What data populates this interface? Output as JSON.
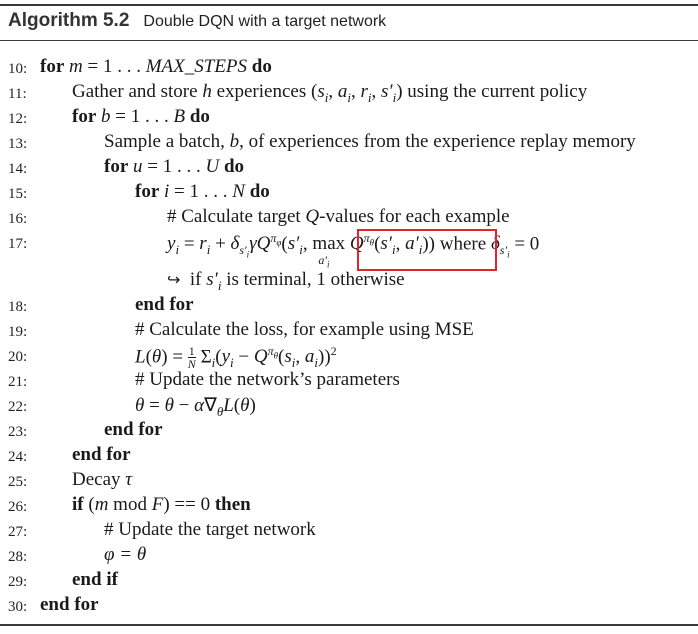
{
  "header": {
    "title": "Algorithm 5.2",
    "caption": "Double DQN with a target network"
  },
  "lines": [
    {
      "n": "10:",
      "text": "for m = 1 . . . MAX_STEPS do"
    },
    {
      "n": "11:",
      "text": "Gather and store h experiences (sᵢ, aᵢ, rᵢ, s′ᵢ) using the current policy"
    },
    {
      "n": "12:",
      "text": "for b = 1 . . . B do"
    },
    {
      "n": "13:",
      "text": "Sample a batch, b, of experiences from the experience replay memory"
    },
    {
      "n": "14:",
      "text": "for u = 1 . . . U do"
    },
    {
      "n": "15:",
      "text": "for i = 1 . . . N do"
    },
    {
      "n": "16:",
      "text": "# Calculate target Q-values for each example"
    },
    {
      "n": "17:",
      "text": "yᵢ = rᵢ + δ_{s′ᵢ} γ Q^{πφ}(s′ᵢ, max_{a′ᵢ} Q^{πθ}(s′ᵢ, a′ᵢ)) where δ_{s′ᵢ} = 0"
    },
    {
      "n": "",
      "text": "↪ if s′ᵢ is terminal, 1 otherwise"
    },
    {
      "n": "18:",
      "text": "end for"
    },
    {
      "n": "19:",
      "text": "# Calculate the loss, for example using MSE"
    },
    {
      "n": "20:",
      "text": "L(θ) = 1/N Σᵢ (yᵢ − Q^{πθ}(sᵢ, aᵢ))²"
    },
    {
      "n": "21:",
      "text": "# Update the network's parameters"
    },
    {
      "n": "22:",
      "text": "θ = θ − α∇θ L(θ)"
    },
    {
      "n": "23:",
      "text": "end for"
    },
    {
      "n": "24:",
      "text": "end for"
    },
    {
      "n": "25:",
      "text": "Decay τ"
    },
    {
      "n": "26:",
      "text": "if (m mod F) == 0 then"
    },
    {
      "n": "27:",
      "text": "# Update the target network"
    },
    {
      "n": "28:",
      "text": "φ = θ"
    },
    {
      "n": "29:",
      "text": "end if"
    },
    {
      "n": "30:",
      "text": "end for"
    }
  ],
  "tokens": {
    "for": "for",
    "do": "do",
    "end_for": "end for",
    "end_if": "end if",
    "if": "if",
    "then": "then",
    "l10_var": "m",
    "l10_eq": " = 1 . . . ",
    "l10_max": "MAX_STEPS",
    "l11_a": "Gather and store ",
    "l11_h": "h",
    "l11_b": " experiences (",
    "l11_s": "s",
    "l11_c": ", ",
    "l11_a2": "a",
    "l11_r": "r",
    "l11_d": ") using the current policy",
    "l12_var": "b",
    "l12_eq": " = 1 . . . ",
    "l12_B": "B",
    "l13": "Sample a batch, ",
    "l13_b": "b",
    "l13_rest": ", of experiences from the experience replay memory",
    "l14_var": "u",
    "l14_eq": " = 1 . . . ",
    "l14_U": "U",
    "l15_var": "i",
    "l15_eq": " = 1 . . . ",
    "l15_N": "N",
    "l16": "# Calculate target ",
    "l16_Q": "Q",
    "l16_rest": "-values for each example",
    "l17_where": " where ",
    "l17b_arrow": "↪",
    "l17b_text1": "if ",
    "l17b_text2": " is terminal, 1 otherwise",
    "l19": "# Calculate the loss, for example using MSE",
    "l21": "# Update the network’s parameters",
    "l25": "Decay ",
    "l25_tau": "τ",
    "l26_mod": " mod ",
    "l26_eq": ") == 0 ",
    "l27": "# Update the target network",
    "l28": "φ = θ"
  }
}
